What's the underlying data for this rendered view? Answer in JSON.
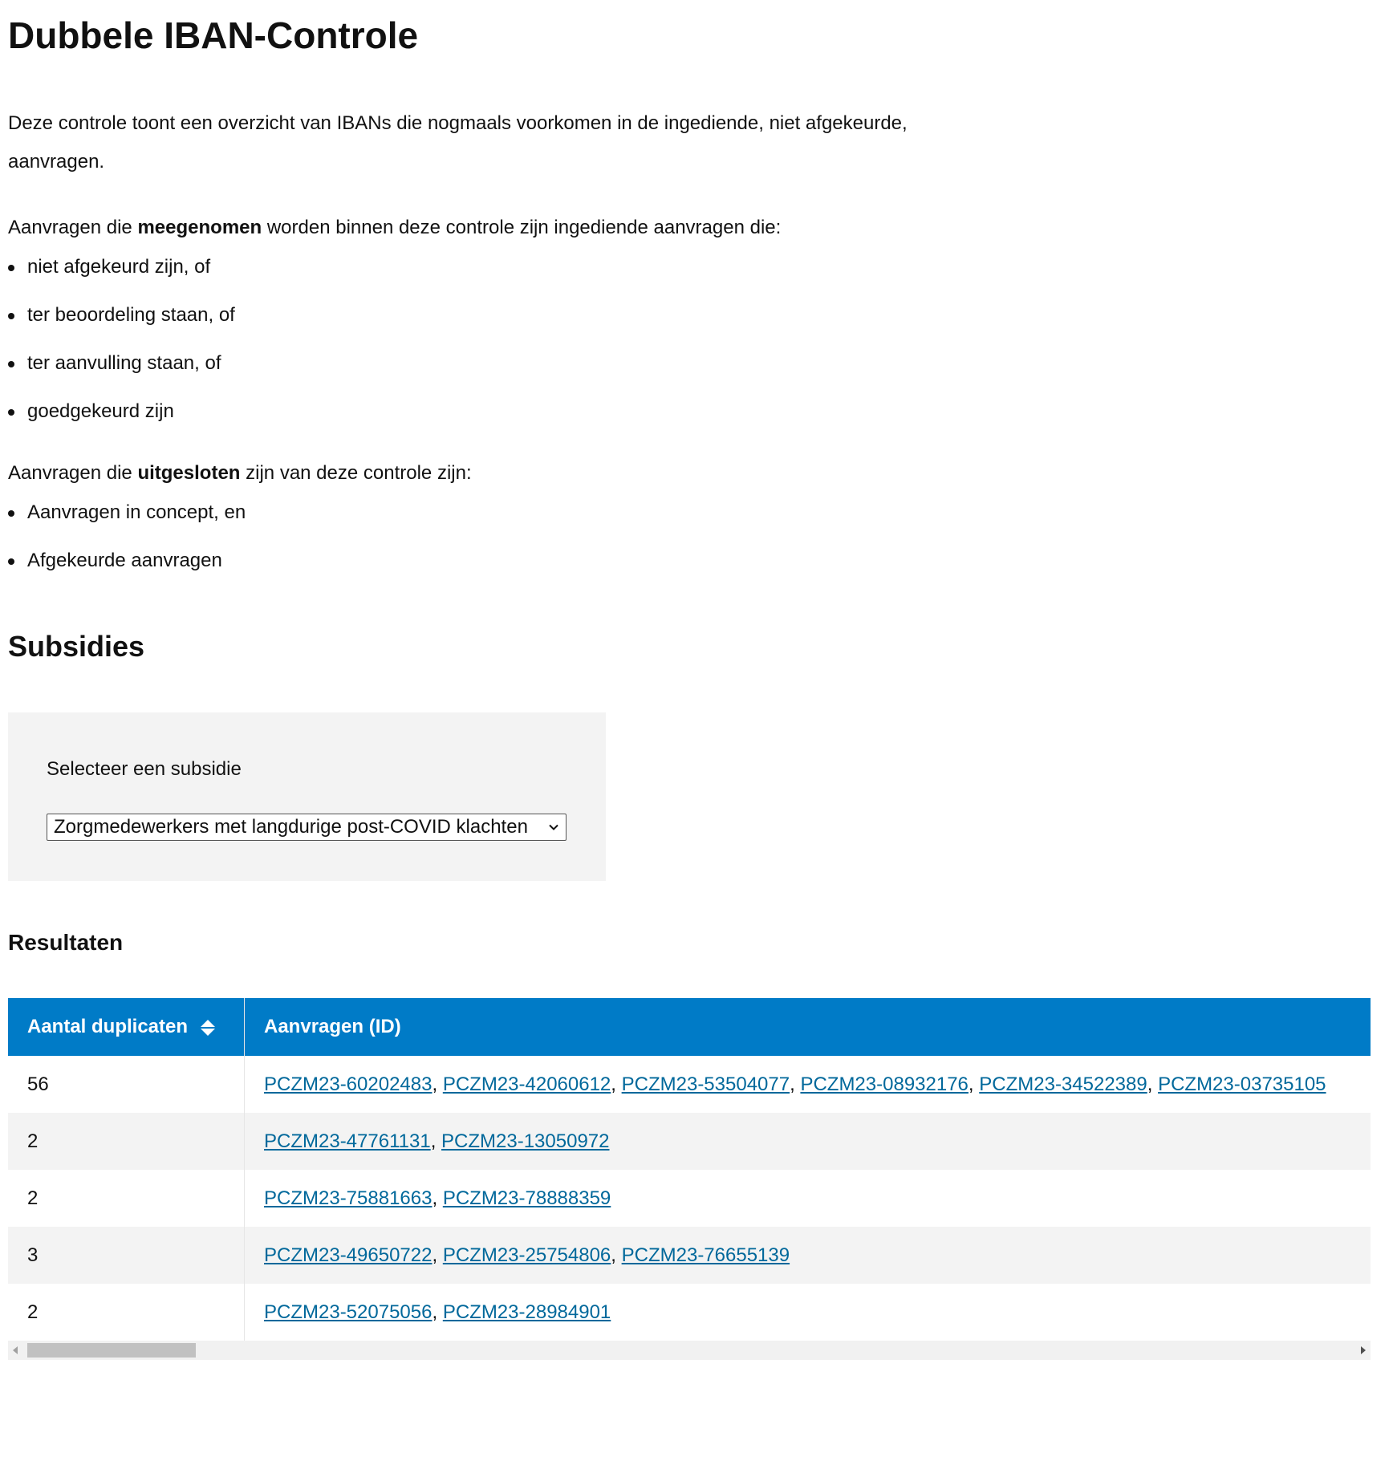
{
  "page": {
    "title": "Dubbele IBAN-Controle",
    "intro": "Deze controle toont een overzicht van IBANs die nogmaals voorkomen in de ingediende, niet afgekeurde, aanvragen.",
    "included": {
      "prefix": "Aanvragen die ",
      "bold": "meegenomen",
      "suffix": " worden binnen deze controle zijn ingediende aanvragen die:",
      "items": [
        "niet afgekeurd zijn, of",
        "ter beoordeling staan, of",
        "ter aanvulling staan, of",
        "goedgekeurd zijn"
      ]
    },
    "excluded": {
      "prefix": "Aanvragen die ",
      "bold": "uitgesloten",
      "suffix": " zijn van deze controle zijn:",
      "items": [
        "Aanvragen in concept, en",
        "Afgekeurde aanvragen"
      ]
    }
  },
  "subsidies": {
    "heading": "Subsidies",
    "select_label": "Selecteer een subsidie",
    "selected_value": "Zorgmedewerkers met langdurige post-COVID klachten"
  },
  "results": {
    "heading": "Resultaten",
    "columns": [
      "Aantal duplicaten",
      "Aanvragen (ID)"
    ],
    "rows": [
      {
        "count": "56",
        "ids": [
          "PCZM23-60202483",
          "PCZM23-42060612",
          "PCZM23-53504077",
          "PCZM23-08932176",
          "PCZM23-34522389",
          "PCZM23-03735105"
        ]
      },
      {
        "count": "2",
        "ids": [
          "PCZM23-47761131",
          "PCZM23-13050972"
        ]
      },
      {
        "count": "2",
        "ids": [
          "PCZM23-75881663",
          "PCZM23-78888359"
        ]
      },
      {
        "count": "3",
        "ids": [
          "PCZM23-49650722",
          "PCZM23-25754806",
          "PCZM23-76655139"
        ]
      },
      {
        "count": "2",
        "ids": [
          "PCZM23-52075056",
          "PCZM23-28984901"
        ]
      }
    ]
  },
  "colors": {
    "header_bg": "#007bc7",
    "link": "#01689b",
    "stripe": "#f3f3f3"
  }
}
